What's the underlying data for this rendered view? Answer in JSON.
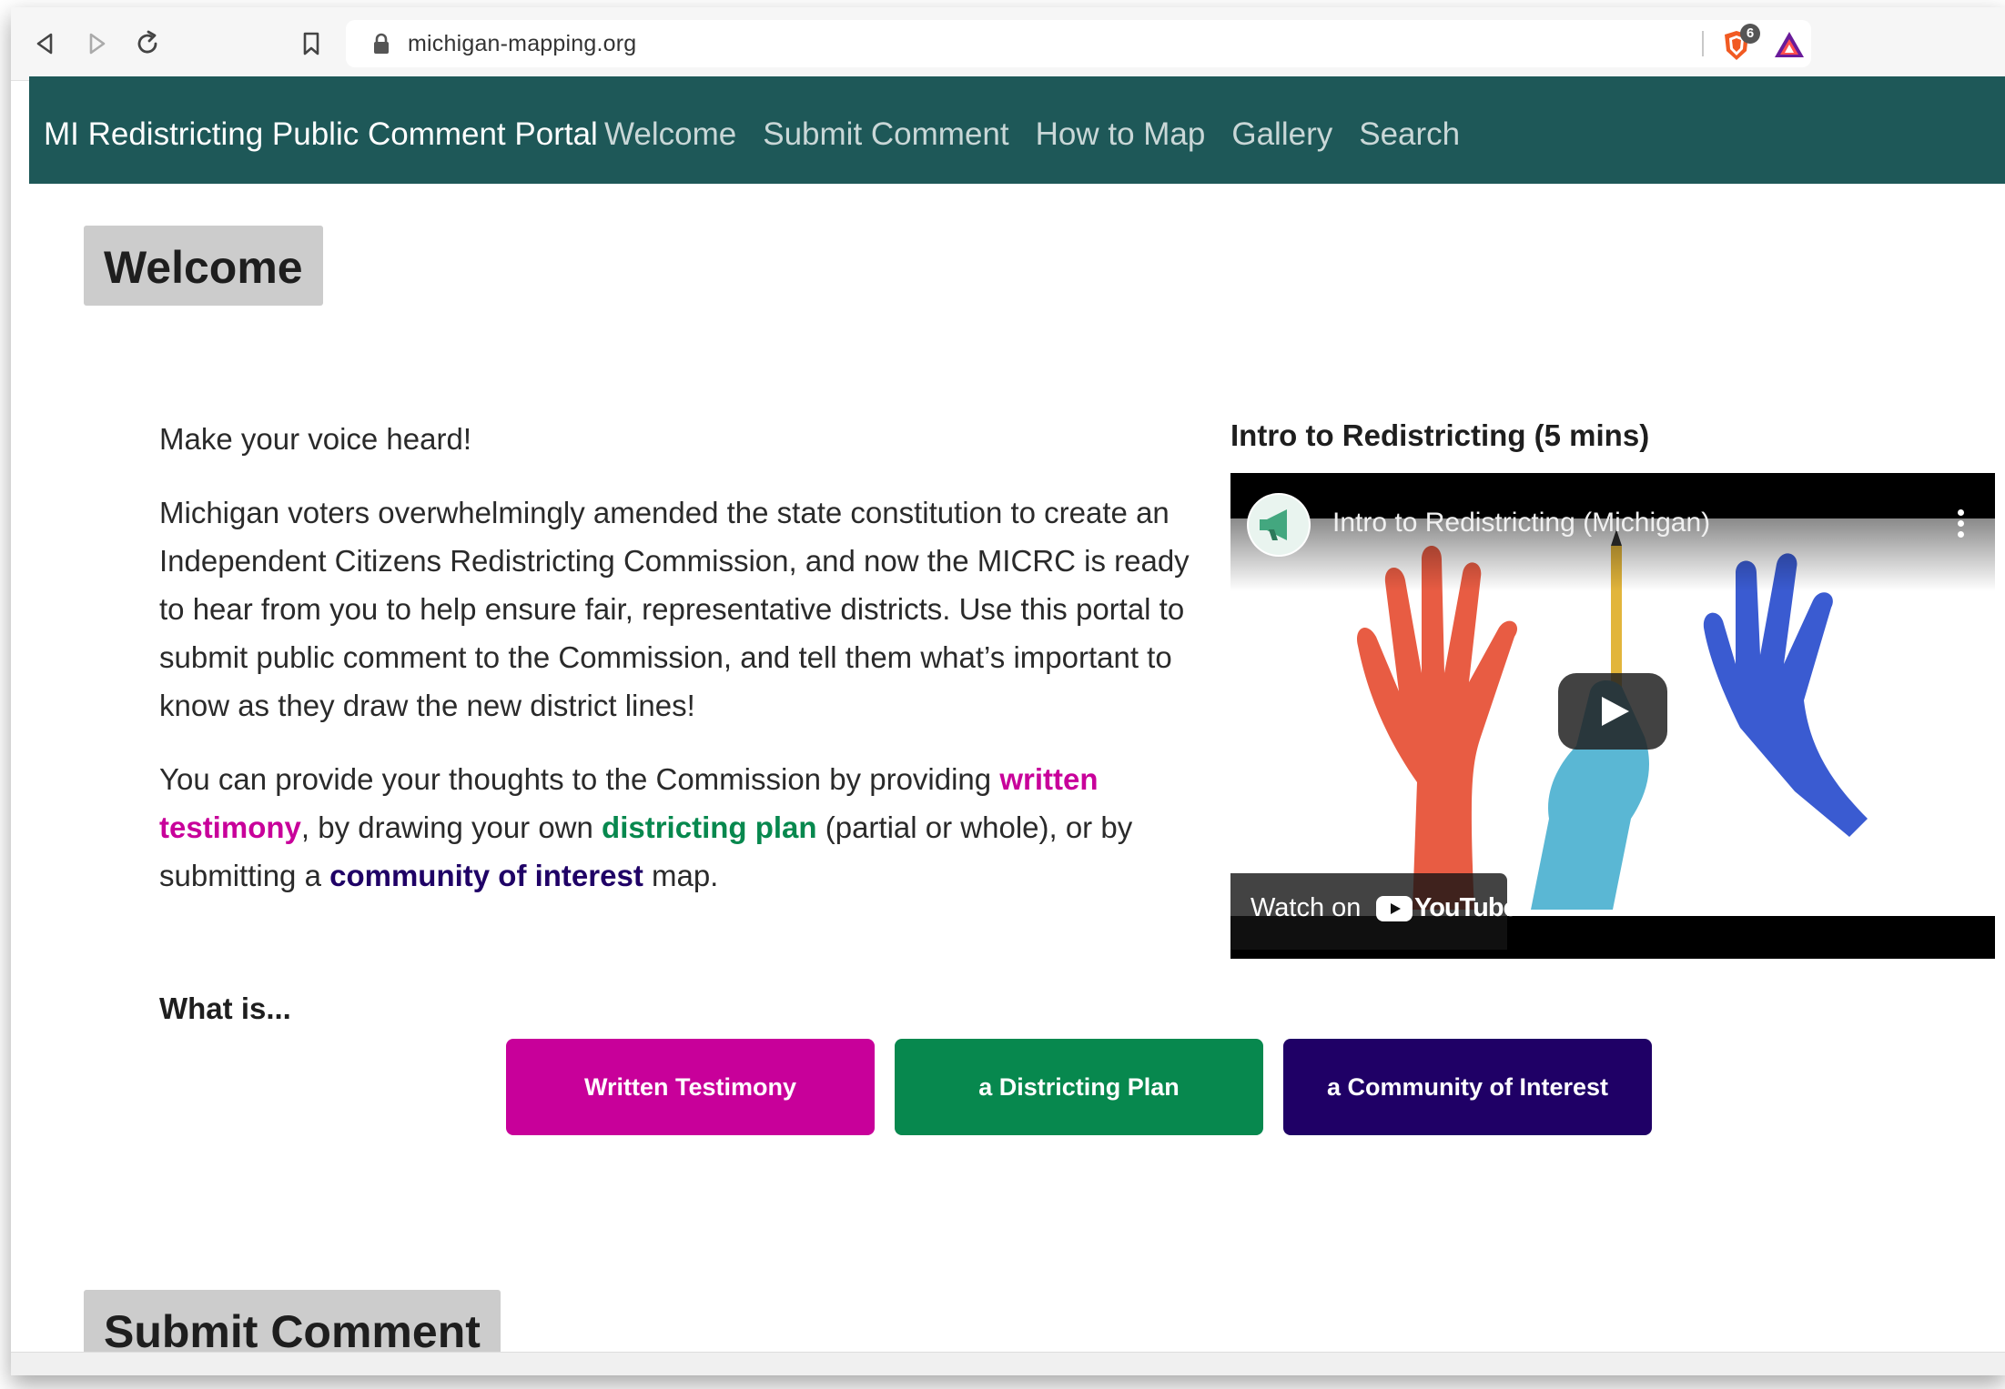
{
  "browser": {
    "url": "michigan-mapping.org",
    "shield_count": "6",
    "icons": [
      "back-icon",
      "forward-icon",
      "reload-icon",
      "bookmark-icon",
      "lock-icon",
      "brave-shield-icon",
      "brave-rewards-icon"
    ]
  },
  "site_nav": {
    "brand": "MI Redistricting Public Comment Portal",
    "links": [
      "Welcome",
      "Submit Comment",
      "How to Map",
      "Gallery",
      "Search"
    ]
  },
  "welcome": {
    "heading": "Welcome",
    "intro": "Make your voice heard!",
    "body": "Michigan voters overwhelmingly amended the state constitution to create an Independent Citizens Redistricting Commission, and now the MICRC is ready to hear from you to help ensure fair, representative districts. Use this portal to submit public comment to the Commission, and tell them what’s important to know as they draw the new district lines!",
    "provide": {
      "part1": "You can provide your thoughts to the Commission by providing ",
      "link_testimony": "written testimony",
      "part2": ", by drawing your own ",
      "link_plan": "districting plan",
      "part3": " (partial or whole), or by submitting a ",
      "link_coi": "community of interest",
      "part4": " map."
    }
  },
  "video": {
    "section_title": "Intro to Redistricting (5 mins)",
    "title": "Intro to Redistricting (Michigan)",
    "watch_on": "Watch on",
    "platform": "YouTube"
  },
  "what_is": {
    "label": "What is...",
    "buttons": [
      "Written Testimony",
      "a Districting Plan",
      "a Community of Interest"
    ]
  },
  "submit": {
    "heading": "Submit Comment"
  },
  "colors": {
    "nav_bg": "#1e5858",
    "testimony": "#c8009a",
    "plan": "#07884e",
    "coi": "#1f0066",
    "heading_bg": "#cccccc"
  }
}
